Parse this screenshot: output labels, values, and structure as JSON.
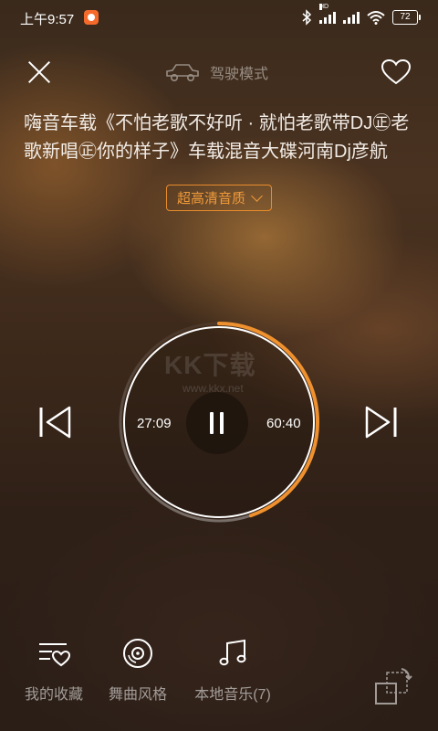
{
  "status_bar": {
    "time": "上午9:57",
    "battery": "72",
    "network_badge": "HD",
    "icons": [
      "app-notification-icon",
      "bluetooth-icon",
      "signal-icon",
      "wifi-icon",
      "battery-icon"
    ]
  },
  "header": {
    "close_icon": "close-icon",
    "mode_label": "驾驶模式",
    "mode_icon": "car-icon",
    "favorite_icon": "heart-icon"
  },
  "song": {
    "title": "嗨音车载《不怕老歌不好听 · 就怕老歌带DJ㊣老歌新唱㊣你的样子》车载混音大碟河南Dj彦航"
  },
  "quality": {
    "label": "超高清音质",
    "icon": "chevron-down-icon"
  },
  "player": {
    "elapsed": "27:09",
    "total": "60:40",
    "progress": 0.4475,
    "accent_color": "#f0912f",
    "controls": {
      "prev_icon": "skip-previous-icon",
      "pause_icon": "pause-icon",
      "next_icon": "skip-next-icon"
    }
  },
  "watermark": {
    "brand": "KK下载",
    "url": "www.kkx.net"
  },
  "bottom_nav": [
    {
      "label": "我的收藏",
      "icon": "favorites-list-icon"
    },
    {
      "label": "舞曲风格",
      "icon": "disc-icon"
    },
    {
      "label": "本地音乐(7)",
      "icon": "music-note-icon"
    }
  ],
  "switch_icon": "rotate-screen-icon"
}
